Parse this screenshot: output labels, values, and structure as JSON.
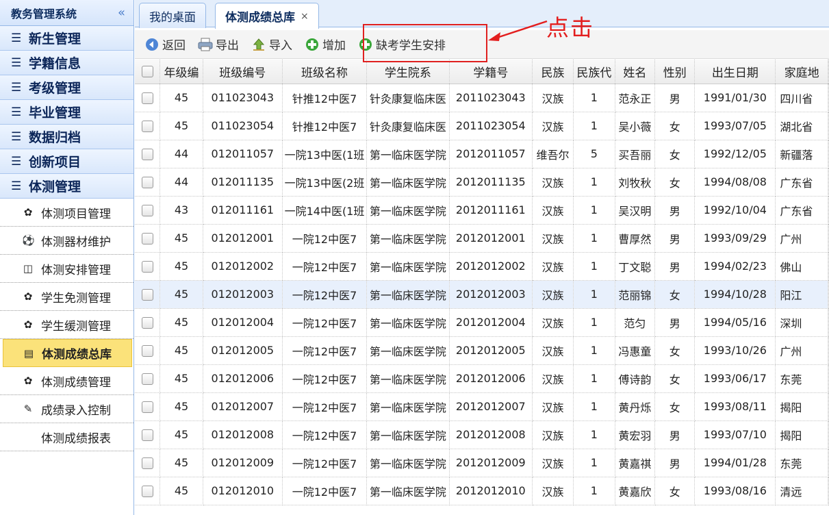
{
  "sidebar": {
    "title": "教务管理系统",
    "collapse_icon": "«",
    "groups": [
      "新生管理",
      "学籍信息",
      "考级管理",
      "毕业管理",
      "数据归档",
      "创新项目",
      "体测管理"
    ],
    "items": [
      {
        "label": "体测项目管理",
        "icon": "gear-icon"
      },
      {
        "label": "体测器材维护",
        "icon": "soccer-ball-icon"
      },
      {
        "label": "体测安排管理",
        "icon": "columns-icon"
      },
      {
        "label": "学生免测管理",
        "icon": "gear-icon"
      },
      {
        "label": "学生缓测管理",
        "icon": "gear-icon"
      },
      {
        "label": "体测成绩总库",
        "icon": "list-icon"
      },
      {
        "label": "体测成绩管理",
        "icon": "gear-icon"
      },
      {
        "label": "成绩录入控制",
        "icon": "pencil-icon"
      },
      {
        "label": "体测成绩报表",
        "icon": ""
      }
    ]
  },
  "tabs": [
    {
      "label": "我的桌面"
    },
    {
      "label": "体测成绩总库",
      "close": "×"
    }
  ],
  "toolbar": {
    "back": "返回",
    "export": "导出",
    "import": "导入",
    "add": "增加",
    "arrange": "缺考学生安排"
  },
  "annotation": "点击",
  "grid": {
    "columns": [
      "年级编",
      "班级编号",
      "班级名称",
      "学生院系",
      "学籍号",
      "民族",
      "民族代",
      "姓名",
      "性别",
      "出生日期",
      "家庭地"
    ],
    "rows": [
      [
        "45",
        "011023043",
        "针推12中医7",
        "针灸康复临床医",
        "2011023043",
        "汉族",
        "1",
        "范永正",
        "男",
        "1991/01/30",
        "四川省"
      ],
      [
        "45",
        "011023054",
        "针推12中医7",
        "针灸康复临床医",
        "2011023054",
        "汉族",
        "1",
        "吴小薇",
        "女",
        "1993/07/05",
        "湖北省"
      ],
      [
        "44",
        "012011057",
        "一院13中医(1班",
        "第一临床医学院",
        "2012011057",
        "维吾尔",
        "5",
        "买吾丽",
        "女",
        "1992/12/05",
        "新疆落"
      ],
      [
        "44",
        "012011135",
        "一院13中医(2班",
        "第一临床医学院",
        "2012011135",
        "汉族",
        "1",
        "刘牧秋",
        "女",
        "1994/08/08",
        "广东省"
      ],
      [
        "43",
        "012011161",
        "一院14中医(1班",
        "第一临床医学院",
        "2012011161",
        "汉族",
        "1",
        "吴汉明",
        "男",
        "1992/10/04",
        "广东省"
      ],
      [
        "45",
        "012012001",
        "一院12中医7",
        "第一临床医学院",
        "2012012001",
        "汉族",
        "1",
        "曹厚然",
        "男",
        "1993/09/29",
        "广州"
      ],
      [
        "45",
        "012012002",
        "一院12中医7",
        "第一临床医学院",
        "2012012002",
        "汉族",
        "1",
        "丁文聪",
        "男",
        "1994/02/23",
        "佛山"
      ],
      [
        "45",
        "012012003",
        "一院12中医7",
        "第一临床医学院",
        "2012012003",
        "汉族",
        "1",
        "范丽锦",
        "女",
        "1994/10/28",
        "阳江"
      ],
      [
        "45",
        "012012004",
        "一院12中医7",
        "第一临床医学院",
        "2012012004",
        "汉族",
        "1",
        "范匀",
        "男",
        "1994/05/16",
        "深圳"
      ],
      [
        "45",
        "012012005",
        "一院12中医7",
        "第一临床医学院",
        "2012012005",
        "汉族",
        "1",
        "冯惠童",
        "女",
        "1993/10/26",
        "广州"
      ],
      [
        "45",
        "012012006",
        "一院12中医7",
        "第一临床医学院",
        "2012012006",
        "汉族",
        "1",
        "傅诗韵",
        "女",
        "1993/06/17",
        "东莞"
      ],
      [
        "45",
        "012012007",
        "一院12中医7",
        "第一临床医学院",
        "2012012007",
        "汉族",
        "1",
        "黄丹烁",
        "女",
        "1993/08/11",
        "揭阳"
      ],
      [
        "45",
        "012012008",
        "一院12中医7",
        "第一临床医学院",
        "2012012008",
        "汉族",
        "1",
        "黄宏羽",
        "男",
        "1993/07/10",
        "揭阳"
      ],
      [
        "45",
        "012012009",
        "一院12中医7",
        "第一临床医学院",
        "2012012009",
        "汉族",
        "1",
        "黄嘉祺",
        "男",
        "1994/01/28",
        "东莞"
      ],
      [
        "45",
        "012012010",
        "一院12中医7",
        "第一临床医学院",
        "2012012010",
        "汉族",
        "1",
        "黄嘉欣",
        "女",
        "1993/08/16",
        "清远"
      ]
    ]
  },
  "colors": {
    "accent": "#95b8e7",
    "active": "#fbe27a",
    "annotation": "#e31e1e"
  }
}
